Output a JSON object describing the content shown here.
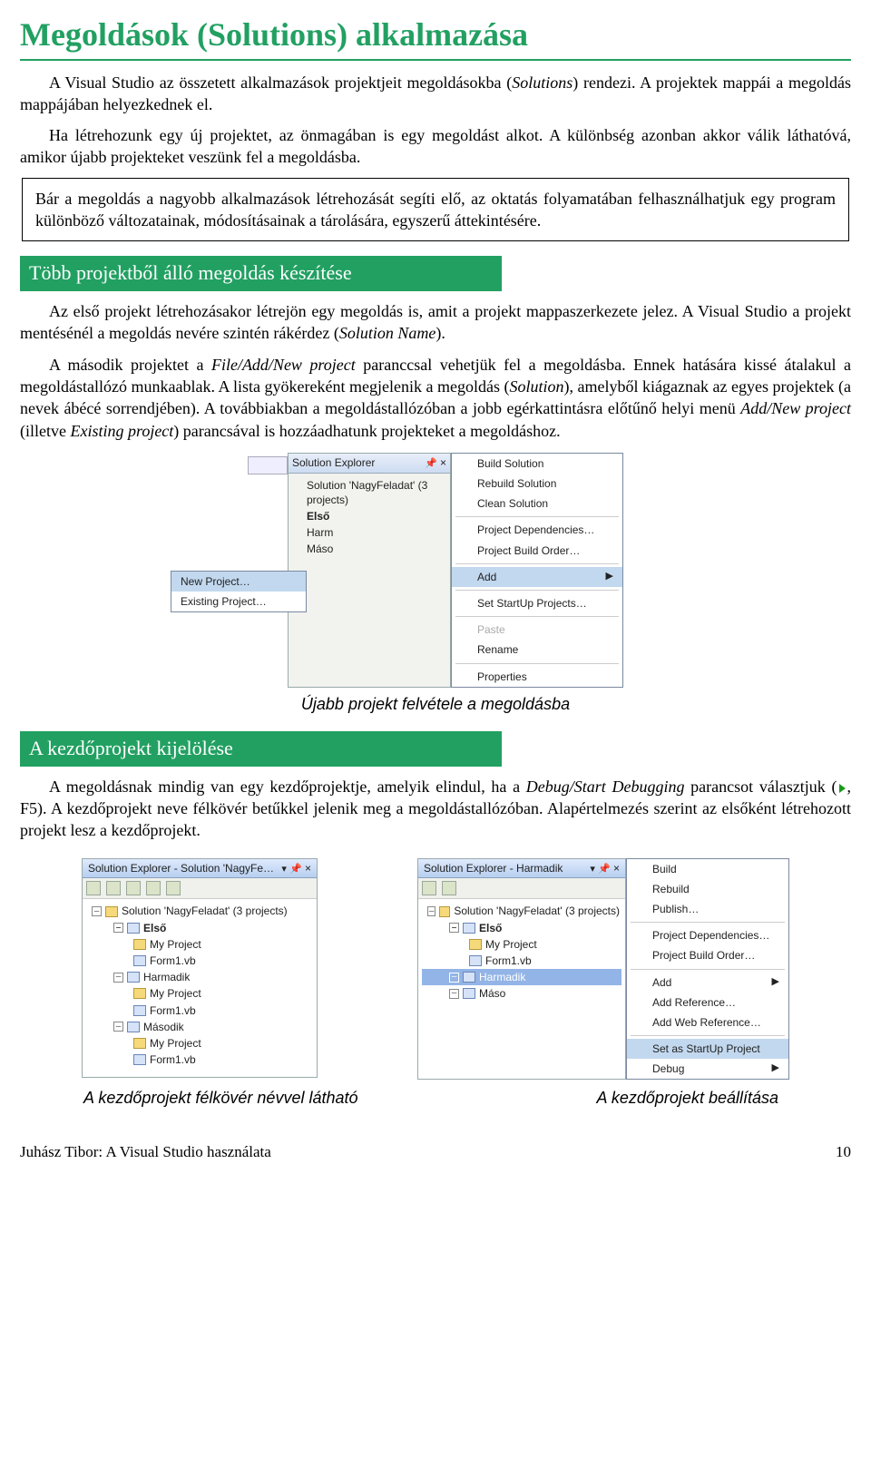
{
  "title": "Megoldások (Solutions) alkalmazása",
  "para1_a": "A Visual Studio az összetett alkalmazások projektjeit megoldásokba (",
  "para1_i1": "Solutions",
  "para1_b": ") rendezi. A projektek mappái a megoldás mappájában helyezkednek el.",
  "para2": "Ha létrehozunk egy új projektet, az önmagában is egy megoldást alkot. A különbség azonban akkor válik láthatóvá, amikor újabb projekteket veszünk fel a megoldásba.",
  "callout": "Bár a megoldás a nagyobb alkalmazások létrehozását segíti elő, az oktatás folyamatában felhasználhatjuk egy program különböző változatainak, módosításainak a tárolására, egyszerű áttekintésére.",
  "sec1": "Több projektből álló megoldás készítése",
  "p3_a": "Az első projekt létrehozásakor létrejön egy megoldás is, amit a projekt mappaszerkezete jelez. A Visual Studio a projekt mentésénél a megoldás nevére szintén rákérdez (",
  "p3_i1": "Solution Name",
  "p3_b": ").",
  "p4_a": "A második projektet a ",
  "p4_i1": "File/Add/New project",
  "p4_b": " paranccsal vehetjük fel a megoldásba. Ennek hatására kissé átalakul a megoldástallózó munkaablak. A lista gyökereként megjelenik a megoldás (",
  "p4_i2": "Solution",
  "p4_c": "), amelyből kiágaznak az egyes projektek (a nevek ábécé sorrendjében). A továbbiakban a megoldástallózóban a jobb egérkattintásra előtűnő helyi menü ",
  "p4_i3": "Add/New project",
  "p4_d": " (illetve ",
  "p4_i4": "Existing project",
  "p4_e": ") parancsával is hozzáadhatunk projekteket a megoldáshoz.",
  "caption1": "Újabb projekt felvétele a megoldásba",
  "sec2": "A kezdőprojekt kijelölése",
  "p5_a": "A megoldásnak mindig van egy kezdőprojektje, amelyik elindul, ha a ",
  "p5_i1": "Debug/Start Debugging",
  "p5_b": " parancsot választjuk (",
  "p5_c": ", F5). A kezdőprojekt neve félkövér betűkkel jelenik meg a megoldástallózóban. Alapértelmezés szerint az elsőként létrehozott projekt lesz a kezdőprojekt.",
  "capL": "A kezdőprojekt félkövér névvel látható",
  "capR": "A kezdőprojekt beállítása",
  "footerL": "Juhász Tibor: A Visual Studio használata",
  "footerR": "10",
  "ui1": {
    "solexp": "Solution Explorer",
    "solroot": "Solution 'NagyFeladat' (3 projects)",
    "elso": "Első",
    "harm": "Harm",
    "maso": "Máso",
    "sub_new": "New Project…",
    "sub_exist": "Existing Project…",
    "m_build": "Build Solution",
    "m_rebuild": "Rebuild Solution",
    "m_clean": "Clean Solution",
    "m_dep": "Project Dependencies…",
    "m_order": "Project Build Order…",
    "m_add": "Add",
    "m_start": "Set StartUp Projects…",
    "m_paste": "Paste",
    "m_rename": "Rename",
    "m_props": "Properties"
  },
  "ui2": {
    "title": "Solution Explorer - Solution 'NagyFe…",
    "root": "Solution 'NagyFeladat' (3 projects)",
    "p1": "Első",
    "p2": "Harmadik",
    "p3": "Második",
    "myproj": "My Project",
    "form": "Form1.vb"
  },
  "ui3": {
    "title": "Solution Explorer - Harmadik",
    "root": "Solution 'NagyFeladat' (3 projects)",
    "p1": "Első",
    "p2": "Harmadik",
    "p3": "Máso",
    "myproj": "My Project",
    "form": "Form1.vb",
    "m_build": "Build",
    "m_rebuild": "Rebuild",
    "m_publish": "Publish…",
    "m_dep": "Project Dependencies…",
    "m_order": "Project Build Order…",
    "m_add": "Add",
    "m_ref": "Add Reference…",
    "m_webref": "Add Web Reference…",
    "m_start": "Set as StartUp Project",
    "m_debug": "Debug"
  }
}
